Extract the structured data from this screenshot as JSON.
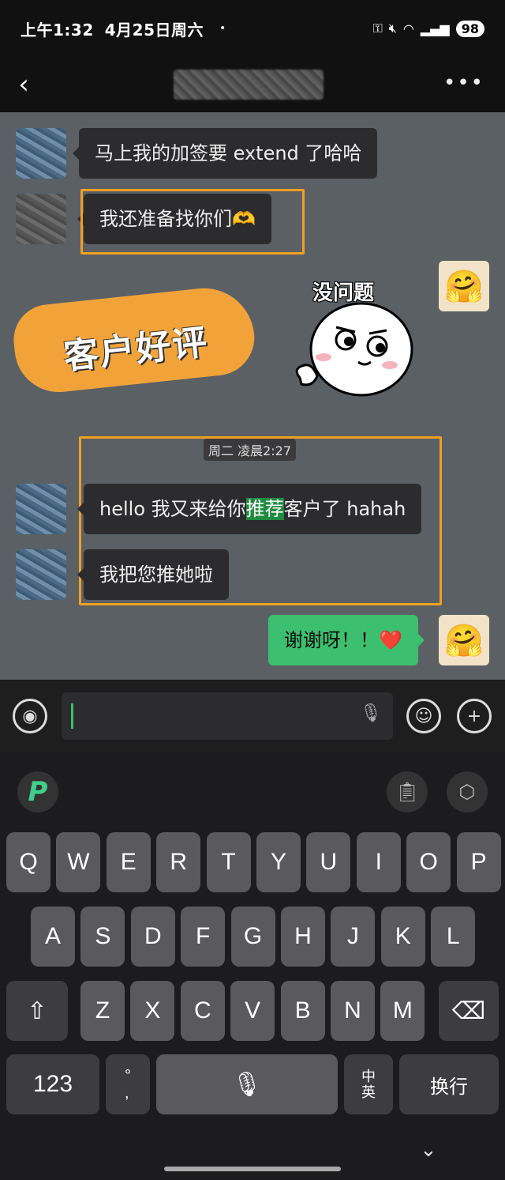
{
  "status_bar": {
    "time": "上午1:32",
    "date": "4月25日周六",
    "dot": "•",
    "icons": [
      "key-icon",
      "mute-icon",
      "wifi-icon",
      "signal-icon"
    ],
    "battery": "98"
  },
  "nav": {
    "back": "‹",
    "more": "•••"
  },
  "chat": {
    "messages": [
      {
        "text": "马上我的加签要 extend 了哈哈"
      },
      {
        "text": "我还准备找你们🫶"
      },
      {
        "text_pre": "hello 我又来给你",
        "text_hl": "推荐",
        "text_post": "客户了 hahah"
      },
      {
        "text": "我把您推她啦"
      },
      {
        "text": "谢谢呀！！❤️"
      }
    ],
    "timestamp": "周二 凌晨2:27",
    "review_label": "客户好评",
    "sticker_text": "没问题",
    "colors": {
      "highlight": "#f0a020",
      "sent_bubble": "#3cbf6e"
    }
  },
  "input": {
    "voice_icon": "voice-icon",
    "emoji_icon": "emoji-icon",
    "plus_icon": "plus-icon"
  },
  "keyboard": {
    "row1": [
      "Q",
      "W",
      "E",
      "R",
      "T",
      "Y",
      "U",
      "I",
      "O",
      "P"
    ],
    "row2": [
      "A",
      "S",
      "D",
      "F",
      "G",
      "H",
      "J",
      "K",
      "L"
    ],
    "row3": [
      "Z",
      "X",
      "C",
      "V",
      "B",
      "N",
      "M"
    ],
    "num_key": "123",
    "punct_key": "°\n,",
    "lang_key": "中\n英",
    "enter_key": "换行",
    "logo": "P"
  }
}
